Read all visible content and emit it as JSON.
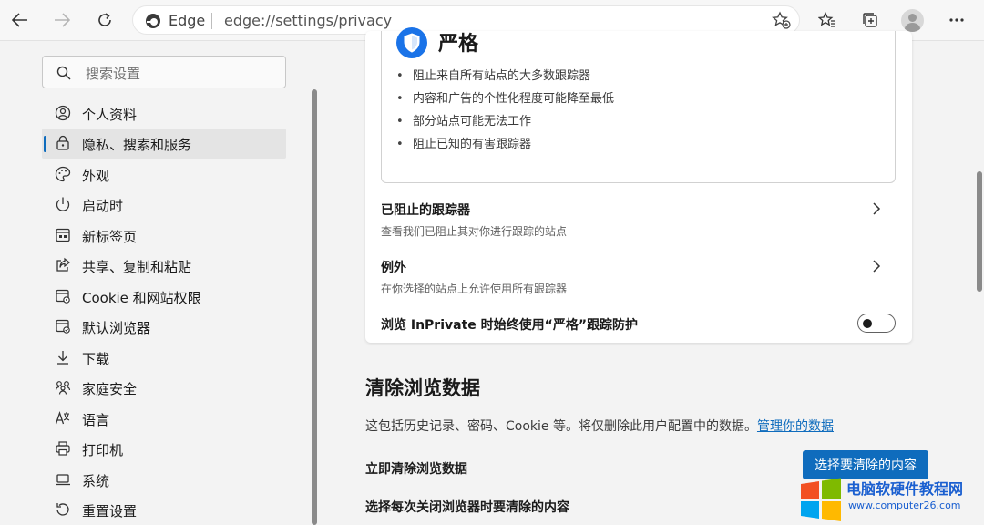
{
  "toolbar": {
    "brand": "Edge",
    "url": "edge://settings/privacy",
    "icons": [
      "back-icon",
      "forward-icon",
      "refresh-icon",
      "favorite-add-icon",
      "favorites-icon",
      "collections-icon",
      "profile-icon",
      "more-icon"
    ]
  },
  "sidebar": {
    "search_placeholder": "搜索设置",
    "items": [
      {
        "label": "个人资料",
        "icon": "profile-icon"
      },
      {
        "label": "隐私、搜索和服务",
        "icon": "lock-icon",
        "active": true
      },
      {
        "label": "外观",
        "icon": "palette-icon"
      },
      {
        "label": "启动时",
        "icon": "power-icon"
      },
      {
        "label": "新标签页",
        "icon": "new-tab-icon"
      },
      {
        "label": "共享、复制和粘贴",
        "icon": "share-icon"
      },
      {
        "label": "Cookie 和网站权限",
        "icon": "site-permissions-icon"
      },
      {
        "label": "默认浏览器",
        "icon": "browser-icon"
      },
      {
        "label": "下载",
        "icon": "download-icon"
      },
      {
        "label": "家庭安全",
        "icon": "family-icon"
      },
      {
        "label": "语言",
        "icon": "language-icon"
      },
      {
        "label": "打印机",
        "icon": "printer-icon"
      },
      {
        "label": "系统",
        "icon": "laptop-icon"
      },
      {
        "label": "重置设置",
        "icon": "reset-icon"
      }
    ]
  },
  "tracking": {
    "strict_title": "严格",
    "bullets": [
      "阻止来自所有站点的大多数跟踪器",
      "内容和广告的个性化程度可能降至最低",
      "部分站点可能无法工作",
      "阻止已知的有害跟踪器"
    ],
    "blocked_title": "已阻止的跟踪器",
    "blocked_sub": "查看我们已阻止其对你进行跟踪的站点",
    "exceptions_title": "例外",
    "exceptions_sub": "在你选择的站点上允许使用所有跟踪器",
    "inprivate_label": "浏览 InPrivate 时始终使用“严格”跟踪防护",
    "inprivate_on": false
  },
  "clear_data": {
    "title": "清除浏览数据",
    "description": "这包括历史记录、密码、Cookie 等。将仅删除此用户配置中的数据。",
    "manage_link": "管理你的数据",
    "clear_now_label": "立即清除浏览数据",
    "choose_button": "选择要清除的内容",
    "on_close_label": "选择每次关闭浏览器时要清除的内容"
  },
  "watermark": {
    "title": "电脑软硬件教程网",
    "url": "www.computer26.com"
  },
  "colors": {
    "accent": "#0f6cbd",
    "shield": "#1a73e8"
  }
}
